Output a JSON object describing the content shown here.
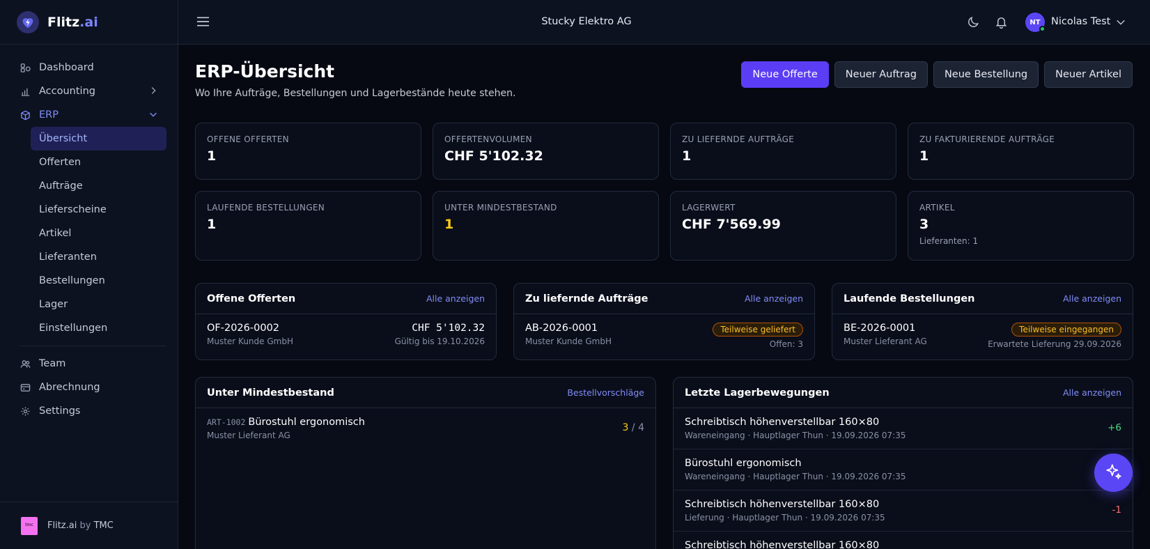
{
  "brand": {
    "name": "Flitz",
    "suffix": ".ai"
  },
  "sidebar": {
    "items": [
      {
        "label": "Dashboard",
        "icon": "dashboard-icon"
      },
      {
        "label": "Accounting",
        "icon": "chart-icon"
      },
      {
        "label": "ERP",
        "icon": "cube-icon"
      }
    ],
    "erp_sub": [
      {
        "label": "Übersicht",
        "active": true
      },
      {
        "label": "Offerten"
      },
      {
        "label": "Aufträge"
      },
      {
        "label": "Lieferscheine"
      },
      {
        "label": "Artikel"
      },
      {
        "label": "Lieferanten"
      },
      {
        "label": "Bestellungen"
      },
      {
        "label": "Lager"
      },
      {
        "label": "Einstellungen"
      }
    ],
    "bottom": [
      {
        "label": "Team",
        "icon": "team-icon"
      },
      {
        "label": "Abrechnung",
        "icon": "card-icon"
      },
      {
        "label": "Settings",
        "icon": "gear-icon"
      }
    ],
    "footer": {
      "app": "Flitz.ai",
      "by": "by",
      "company": "TMC",
      "logo_text": "tmc"
    }
  },
  "topbar": {
    "company": "Stucky Elektro AG",
    "user": {
      "initials": "NT",
      "name": "Nicolas Test"
    }
  },
  "page": {
    "title": "ERP-Übersicht",
    "subtitle": "Wo Ihre Aufträge, Bestellungen und Lagerbestände heute stehen.",
    "actions": [
      "Neue Offerte",
      "Neuer Auftrag",
      "Neue Bestellung",
      "Neuer Artikel"
    ]
  },
  "kpis": [
    {
      "label": "Offene Offerten",
      "value": "1"
    },
    {
      "label": "Offertenvolumen",
      "value": "CHF 5'102.32"
    },
    {
      "label": "Zu liefernde Aufträge",
      "value": "1"
    },
    {
      "label": "Zu fakturierende Aufträge",
      "value": "1"
    },
    {
      "label": "Laufende Bestellungen",
      "value": "1"
    },
    {
      "label": "Unter Mindestbestand",
      "value": "1"
    },
    {
      "label": "Lagerwert",
      "value": "CHF 7'569.99"
    },
    {
      "label": "Artikel",
      "value": "3",
      "note": "Lieferanten: 1"
    }
  ],
  "cards": {
    "offerten": {
      "title": "Offene Offerten",
      "link": "Alle anzeigen",
      "row": {
        "id": "OF-2026-0002",
        "customer": "Muster Kunde GmbH",
        "amount": "CHF 5'102.32",
        "valid": "Gültig bis 19.10.2026"
      }
    },
    "auftraege": {
      "title": "Zu liefernde Aufträge",
      "link": "Alle anzeigen",
      "row": {
        "id": "AB-2026-0001",
        "customer": "Muster Kunde GmbH",
        "status": "Teilweise geliefert",
        "open": "Offen: 3"
      }
    },
    "bestellungen": {
      "title": "Laufende Bestellungen",
      "link": "Alle anzeigen",
      "row": {
        "id": "BE-2026-0001",
        "supplier": "Muster Lieferant AG",
        "status": "Teilweise eingegangen",
        "expected": "Erwartete Lieferung 29.09.2026"
      }
    },
    "mindestbestand": {
      "title": "Unter Mindestbestand",
      "link": "Bestellvorschläge",
      "row": {
        "sku": "ART-1002",
        "name": "Bürostuhl ergonomisch",
        "supplier": "Muster Lieferant AG",
        "qty": "3",
        "sep": "/",
        "min": "4"
      }
    },
    "lagerbewegungen": {
      "title": "Letzte Lagerbewegungen",
      "link": "Alle anzeigen",
      "rows": [
        {
          "name": "Schreibtisch höhenverstellbar 160×80",
          "meta": "Wareneingang · Hauptlager Thun · 19.09.2026 07:35",
          "delta": "+6"
        },
        {
          "name": "Bürostuhl ergonomisch",
          "meta": "Wareneingang · Hauptlager Thun · 19.09.2026 07:35",
          "delta": ""
        },
        {
          "name": "Schreibtisch höhenverstellbar 160×80",
          "meta": "Lieferung · Hauptlager Thun · 19.09.2026 07:35",
          "delta": "-1"
        },
        {
          "name": "Schreibtisch höhenverstellbar 160×80",
          "meta": "",
          "delta": ""
        }
      ]
    }
  }
}
